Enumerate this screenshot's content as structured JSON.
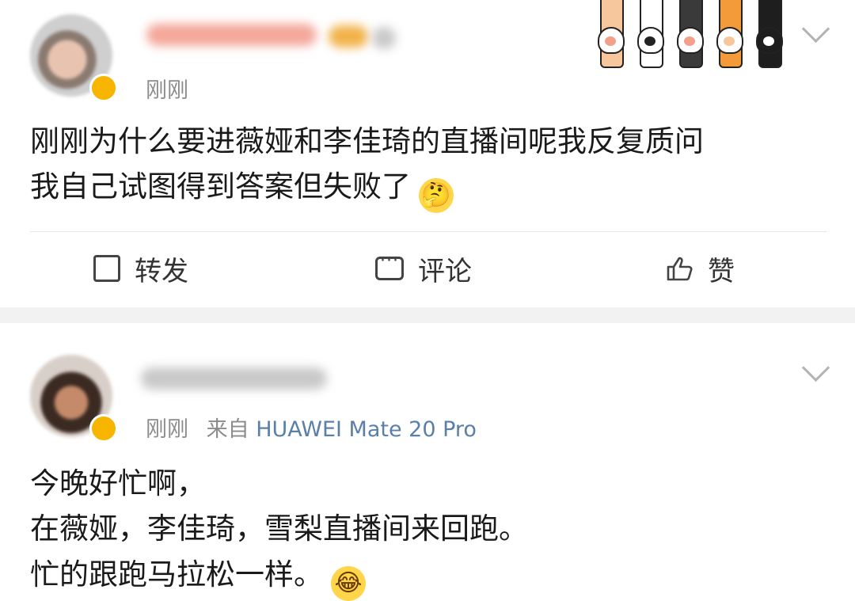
{
  "post1": {
    "avatar_icon": "avatar-icon",
    "time": "刚刚",
    "content_lines": [
      "刚刚为什么要进薇娅和李佳琦的直播间呢我反复质问",
      "我自己试图得到答案但失败了"
    ],
    "emoji_icon": "thinking-emoji",
    "emoji_glyph": "🤔",
    "actions": {
      "repost_label": "转发",
      "comment_label": "评论",
      "like_label": "赞"
    }
  },
  "post2": {
    "avatar_icon": "avatar-icon",
    "time": "刚刚",
    "from_prefix": "来自",
    "device": "HUAWEI Mate 20 Pro",
    "content_lines": [
      "今晚好忙啊，",
      "在薇娅，李佳琦，雪梨直播间来回跑。",
      "忙的跟跑马拉松一样。"
    ],
    "emoji_icon": "laughing-crying-emoji",
    "emoji_glyph": "😂"
  },
  "colors": {
    "meta_gray": "#8c8c8c",
    "device_link": "#5a7fa8",
    "separator": "#f2f2f2",
    "vip_badge": "#f7b500"
  }
}
